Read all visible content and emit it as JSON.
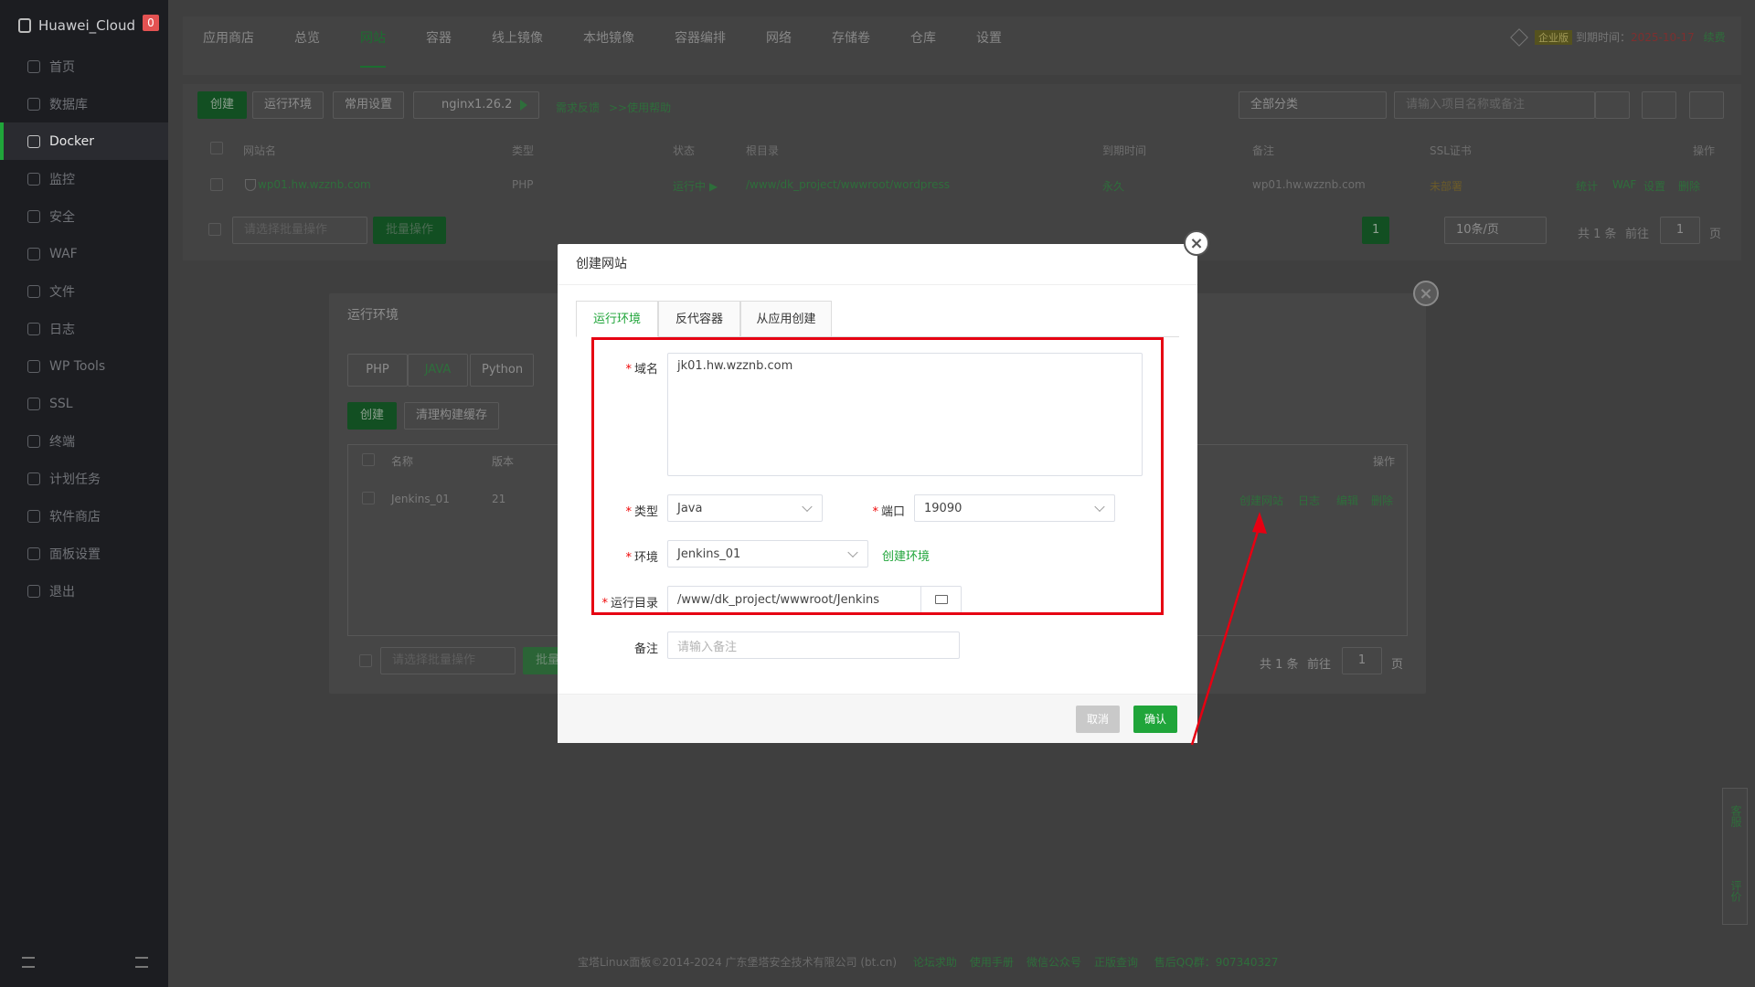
{
  "sidebar": {
    "brand": "Huawei_Cloud",
    "badge": "0",
    "items": [
      {
        "label": "首页"
      },
      {
        "label": "数据库"
      },
      {
        "label": "Docker"
      },
      {
        "label": "监控"
      },
      {
        "label": "安全"
      },
      {
        "label": "WAF"
      },
      {
        "label": "文件"
      },
      {
        "label": "日志"
      },
      {
        "label": "WP Tools"
      },
      {
        "label": "SSL"
      },
      {
        "label": "终端"
      },
      {
        "label": "计划任务"
      },
      {
        "label": "软件商店"
      },
      {
        "label": "面板设置"
      },
      {
        "label": "退出"
      }
    ],
    "active_index": 2
  },
  "topbar": {
    "tabs": [
      {
        "label": "应用商店"
      },
      {
        "label": "总览"
      },
      {
        "label": "网站"
      },
      {
        "label": "容器"
      },
      {
        "label": "线上镜像"
      },
      {
        "label": "本地镜像"
      },
      {
        "label": "容器编排"
      },
      {
        "label": "网络"
      },
      {
        "label": "存储卷"
      },
      {
        "label": "仓库"
      },
      {
        "label": "设置"
      }
    ],
    "active_index": 2,
    "edition": "企业版",
    "expire_label": "到期时间：",
    "expire_date": "2025-10-17",
    "renew": "续费"
  },
  "toolbar": {
    "create": "创建",
    "runtime": "运行环境",
    "common": "常用设置",
    "nginx": "nginx1.26.2",
    "feedback": "需求反馈",
    "help": ">>使用帮助",
    "category": "全部分类",
    "search_placeholder": "请输入项目名称或备注"
  },
  "site_table": {
    "headers": [
      "网站名",
      "类型",
      "状态",
      "根目录",
      "到期时间",
      "备注",
      "SSL证书",
      "操作"
    ],
    "row": {
      "name": "wp01.hw.wzznb.com",
      "type": "PHP",
      "status": "运行中",
      "root": "/www/dk_project/wwwroot/wordpress",
      "expire": "永久",
      "remark": "wp01.hw.wzznb.com",
      "ssl": "未部署",
      "actions": [
        "统计",
        "WAF",
        "设置",
        "删除"
      ]
    },
    "batch_placeholder": "请选择批量操作",
    "batch_btn": "批量操作",
    "page": "1",
    "per_page": "10条/页",
    "total": "共 1 条",
    "goto": "前往",
    "goto_page": "1",
    "page_unit": "页"
  },
  "runtime_dialog": {
    "title": "运行环境",
    "tabs": [
      "PHP",
      "JAVA",
      "Python"
    ],
    "active_tab": 1,
    "create": "创建",
    "clear_cache": "清理构建缓存",
    "headers": {
      "name": "名称",
      "version": "版本",
      "ops": "操作"
    },
    "row": {
      "name": "Jenkins_01",
      "version": "21",
      "actions": [
        "创建网站",
        "日志",
        "编辑",
        "删除"
      ]
    },
    "batch_placeholder": "请选择批量操作",
    "batch_btn": "批量",
    "total": "共 1 条",
    "goto": "前往",
    "goto_page": "1",
    "page_unit": "页"
  },
  "modal": {
    "title": "创建网站",
    "tabs": [
      "运行环境",
      "反代容器",
      "从应用创建"
    ],
    "active_tab": 0,
    "domain_label": "域名",
    "domain_value": "jk01.hw.wzznb.com",
    "type_label": "类型",
    "type_value": "Java",
    "port_label": "端口",
    "port_value": "19090",
    "env_label": "环境",
    "env_value": "Jenkins_01",
    "create_env": "创建环境",
    "dir_label": "运行目录",
    "dir_value": "/www/dk_project/wwwroot/Jenkins",
    "remark_label": "备注",
    "remark_placeholder": "请输入备注",
    "cancel": "取消",
    "confirm": "确认"
  },
  "side_float": {
    "service": "客服",
    "review": "评价"
  },
  "footer": {
    "copyright": "宝塔Linux面板©2014-2024 广东堡塔安全技术有限公司 (bt.cn)",
    "links": [
      "论坛求助",
      "使用手册",
      "微信公众号",
      "正版查询"
    ],
    "qq_label": "售后QQ群：",
    "qq": "907340327"
  },
  "colors": {
    "accent": "#20a53a",
    "highlight": "#e60012",
    "danger": "#ef0808"
  }
}
